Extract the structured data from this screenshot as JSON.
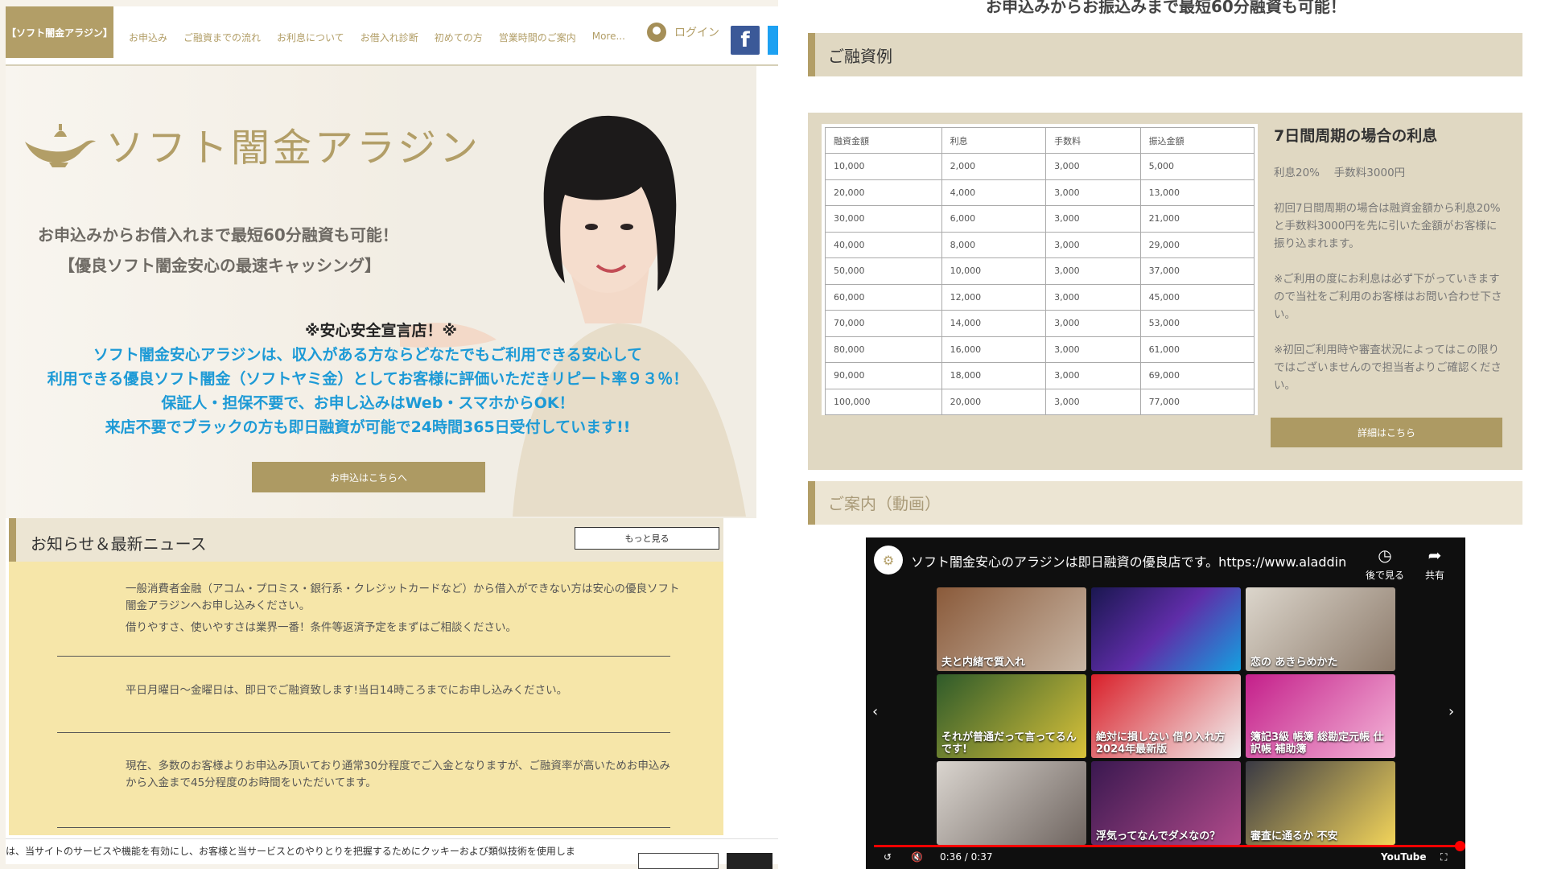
{
  "header": {
    "logo_text": "【ソフト闇金アラジン】",
    "nav": [
      "お申込み",
      "ご融資までの流れ",
      "お利息について",
      "お借入れ診断",
      "初めての方",
      "営業時間のご案内",
      "More..."
    ],
    "login_label": "ログイン",
    "facebook_label": "f"
  },
  "hero": {
    "brand": "ソフト闇金アラジン",
    "tagline1": "お申込みからお借入れまで最短60分融資も可能！",
    "tagline2": "【優良ソフト闇金安心の最速キャッシング】",
    "safe_title": "※安心安全宣言店！※",
    "lines": [
      "ソフト闇金安心アラジンは、収入がある方ならどなたでもご利用できる安心して",
      "利用できる優良ソフト闇金（ソフトヤミ金）としてお客様に評価いただきリピート率９３％！",
      "保証人・担保不要で、お申し込みはWeb・スマホからOK！",
      "来店不要でブラックの方も即日融資が可能で24時間365日受付しています!!"
    ],
    "apply_button": "お申込はこちらへ"
  },
  "news": {
    "title": "お知らせ＆最新ニュース",
    "more_button": "もっと見る",
    "items": [
      "一般消費者金融（アコム・プロミス・銀行系・クレジットカードなど）から借入ができない方は安心の優良ソフト闇金アラジンへお申し込みください。",
      "借りやすさ、使いやすさは業界一番！条件等返済予定をまずはご相談ください。",
      "平日月曜日〜金曜日は、即日でご融資致します!当日14時ころまでにお申し込みください。",
      "現在、多数のお客様よりお申込み頂いており通常30分程度でご入金となりますが、ご融資率が高いためお申込みから入金まで45分程度のお時間をいただいてます。"
    ]
  },
  "cookie_text": "は、当サイトのサービスや機能を有効にし、お客様と当サービスとのやりとりを把握するためにクッキーおよび類似技術を使用しま",
  "right": {
    "top_text": "お申込みからお振込みまで最短60分融資も可能！",
    "loan_section_title": "ご融資例",
    "table": {
      "headers": [
        "融資金額",
        "利息",
        "手数料",
        "振込金額"
      ],
      "rows": [
        [
          "10,000",
          "2,000",
          "3,000",
          "5,000"
        ],
        [
          "20,000",
          "4,000",
          "3,000",
          "13,000"
        ],
        [
          "30,000",
          "6,000",
          "3,000",
          "21,000"
        ],
        [
          "40,000",
          "8,000",
          "3,000",
          "29,000"
        ],
        [
          "50,000",
          "10,000",
          "3,000",
          "37,000"
        ],
        [
          "60,000",
          "12,000",
          "3,000",
          "45,000"
        ],
        [
          "70,000",
          "14,000",
          "3,000",
          "53,000"
        ],
        [
          "80,000",
          "16,000",
          "3,000",
          "61,000"
        ],
        [
          "90,000",
          "18,000",
          "3,000",
          "69,000"
        ],
        [
          "100,000",
          "20,000",
          "3,000",
          "77,000"
        ]
      ]
    },
    "cycle_title": "7日間周期の場合の利息",
    "cycle_text": "利息20%　 手数料3000円\n\n初回7日間周期の場合は融資金額から利息20%と手数料3000円を先に引いた金額がお客様に振り込まれます。\n\n※ご利用の度にお利息は必ず下がっていきますので当社をご利用のお客様はお問い合わせ下さい。\n\n※初回ご利用時や審査状況によってはこの限りではございませんので担当者よりご確認ください。",
    "detail_button": "詳細はこちら",
    "video_section_title": "ご案内（動画）",
    "video": {
      "title": "ソフト闇金安心のアラジンは即日融資の優良店です。https://www.aladdin...",
      "watch_later": "後で見る",
      "share": "共有",
      "thumbs": [
        "夫と内緒で質入れ",
        "",
        "恋の あきらめかた",
        "それが普通だって言ってるんです!",
        "絶対に損しない 借り入れ方 2024年最新版",
        "簿記3級 帳簿 総勘定元帳 仕訳帳 補助簿",
        "",
        "浮気ってなんでダメなの？",
        "審査に通るか 不安"
      ],
      "time": "0:36 / 0:37",
      "brand": "YouTube"
    }
  },
  "colors": {
    "gold": "#b29e67",
    "blue": "#1d9ad6",
    "news_bg": "#f6e6a9",
    "section_bg": "#e0d8c2"
  }
}
